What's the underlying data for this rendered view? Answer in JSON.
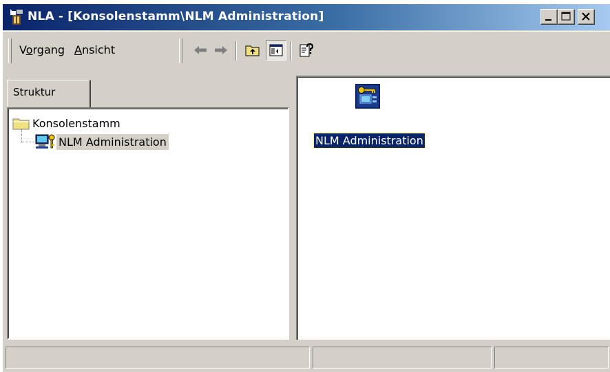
{
  "window": {
    "title": "NLA - [Konsolenstamm\\NLM Administration]",
    "title_gradient": [
      "#0a246a",
      "#a6caf0"
    ],
    "controls": [
      "minimize-icon",
      "maximize-icon",
      "close-icon"
    ]
  },
  "menubar": {
    "items": [
      {
        "label": "Vorgang",
        "underline": "o"
      },
      {
        "label": "Ansicht",
        "underline": "A"
      }
    ],
    "toolbar": [
      "back-arrow-icon",
      "forward-arrow-icon",
      "up-folder-icon",
      "show-hide-tree-icon",
      "help-icon"
    ]
  },
  "tab": {
    "label": "Struktur"
  },
  "tree": {
    "root": {
      "label": "Konsolenstamm",
      "icon": "folder-icon"
    },
    "child": {
      "label": "NLM Administration",
      "icon": "nlm-admin-icon",
      "selected": true
    }
  },
  "result": {
    "item": {
      "label": "NLM Administration",
      "icon": "nlm-admin-large-icon"
    }
  },
  "statusbar": {
    "cells": [
      "",
      "",
      ""
    ]
  },
  "colors": {
    "face": "#d4d0c8",
    "selection": "#0a246a",
    "title_start": "#0a246a"
  }
}
